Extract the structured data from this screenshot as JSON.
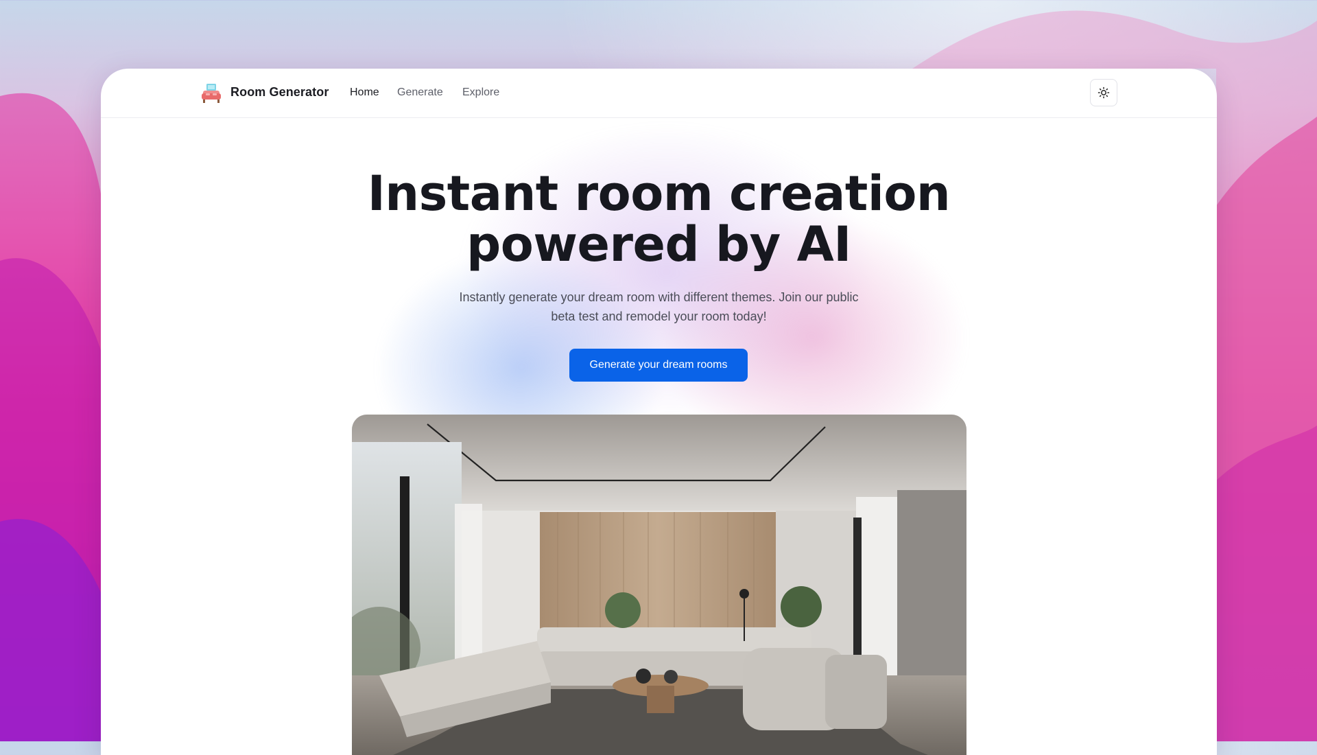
{
  "app": {
    "name": "Room Generator",
    "logo_icon": "sofa-icon"
  },
  "nav": {
    "links": [
      {
        "label": "Home",
        "active": true
      },
      {
        "label": "Generate",
        "active": false
      },
      {
        "label": "Explore",
        "active": false
      }
    ],
    "theme_toggle_icon": "sun-icon"
  },
  "hero": {
    "title_line1": "Instant room creation",
    "title_line2": "powered by AI",
    "subtitle": "Instantly generate your dream room with different themes. Join our public beta test and remodel your room today!",
    "cta_label": "Generate your dream rooms"
  },
  "colors": {
    "primary": "#0a63e8",
    "text": "#17181f",
    "muted": "#5d5f69"
  }
}
